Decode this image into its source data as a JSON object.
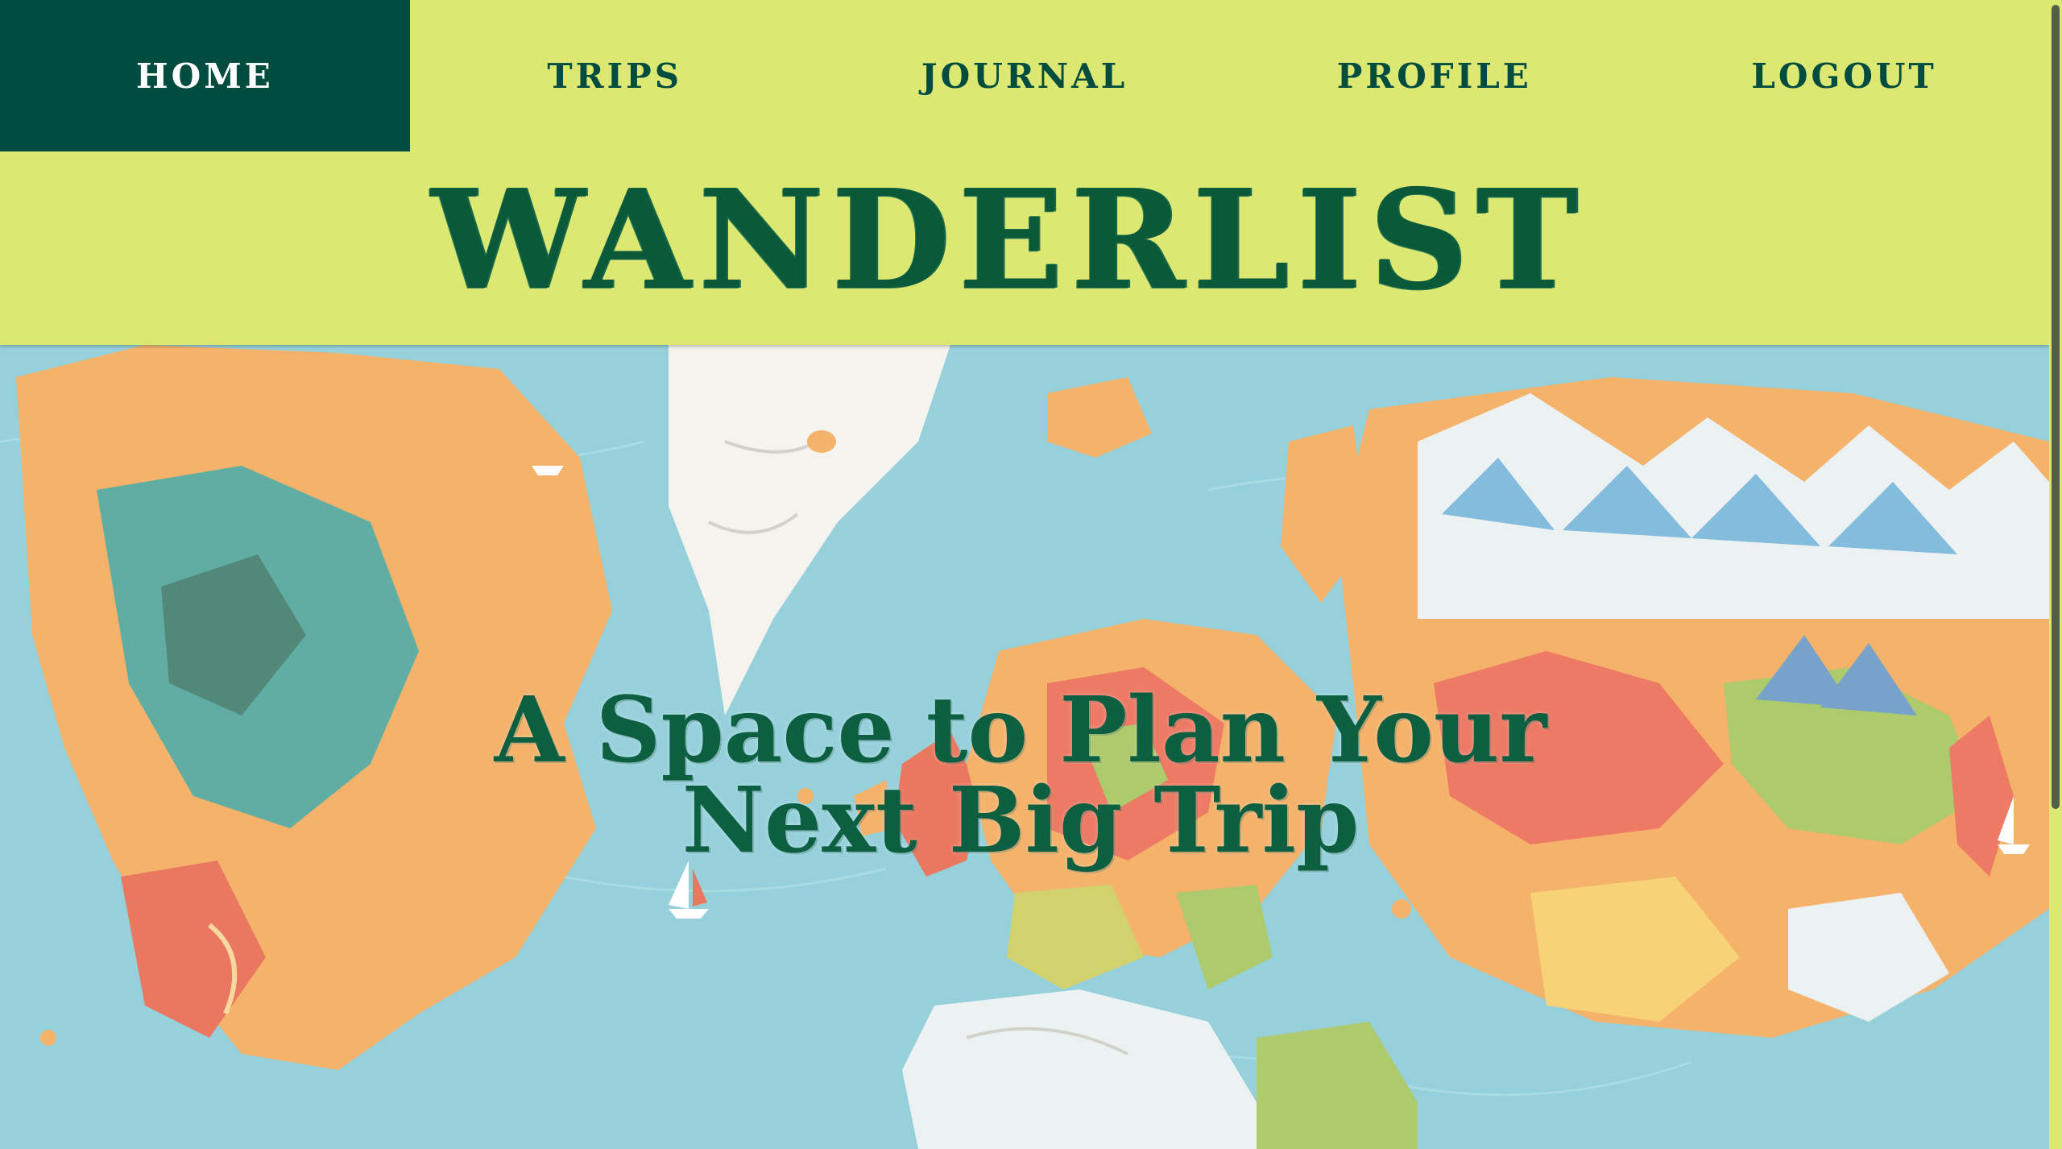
{
  "nav": {
    "items": [
      {
        "label": "HOME",
        "active": true
      },
      {
        "label": "TRIPS",
        "active": false
      },
      {
        "label": "JOURNAL",
        "active": false
      },
      {
        "label": "PROFILE",
        "active": false
      },
      {
        "label": "LOGOUT",
        "active": false
      }
    ]
  },
  "header": {
    "title": "WANDERLIST"
  },
  "hero": {
    "tagline_line1": "A Space to Plan Your",
    "tagline_line2": "Next Big Trip",
    "background": "illustrated-world-map"
  },
  "colors": {
    "nav_background": "#dde873",
    "active_background": "#004d40",
    "primary_text": "#004d40",
    "ocean": "#7fc7d3"
  }
}
